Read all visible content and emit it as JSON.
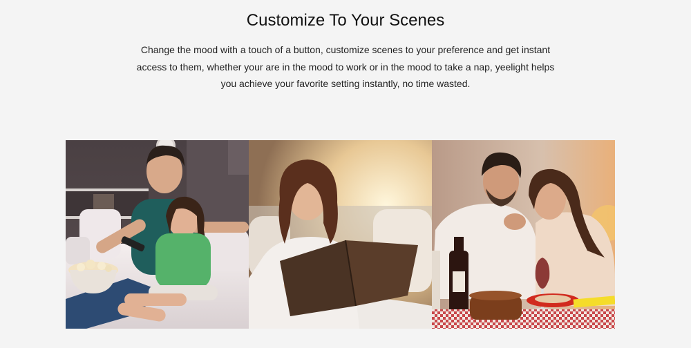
{
  "heading": "Customize To Your Scenes",
  "description": {
    "lines": [
      "Change the mood with a touch of a button, customize scenes to your preference and get instant",
      "access to them, whether your are in the mood to work or in the mood to take a nap, yeelight helps",
      "you achieve your favorite setting instantly, no time wasted."
    ]
  },
  "gallery": {
    "photos": [
      {
        "subject": "father-daughter-watching-tv"
      },
      {
        "subject": "woman-reading-book"
      },
      {
        "subject": "couple-dinner-wine"
      }
    ]
  },
  "colors": {
    "background": "#f4f4f4",
    "text": "#222222"
  }
}
